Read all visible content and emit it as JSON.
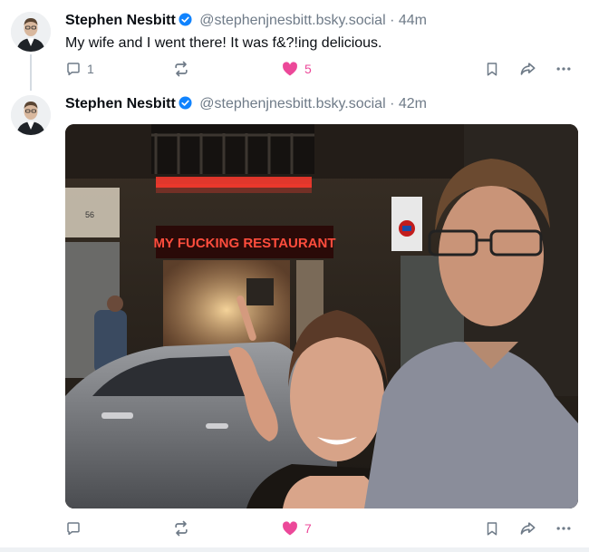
{
  "posts": [
    {
      "author": "Stephen Nesbitt",
      "handle": "@stephenjnesbitt.bsky.social",
      "separator": "·",
      "time": "44m",
      "text": "My wife and I went there! It was f&?!ing delicious.",
      "replies": "1",
      "reposts": "",
      "likes": "5",
      "liked": true
    },
    {
      "author": "Stephen Nesbitt",
      "handle": "@stephenjnesbitt.bsky.social",
      "separator": "·",
      "time": "42m",
      "image": {
        "sign_text": "MY FUCKING RESTAURANT",
        "house_number": "56"
      },
      "replies": "",
      "reposts": "",
      "likes": "7",
      "liked": true
    }
  ],
  "colors": {
    "accent": "#1083fe",
    "like": "#ec4899",
    "muted": "#6f7b88",
    "sign": "#ff3a2e"
  }
}
